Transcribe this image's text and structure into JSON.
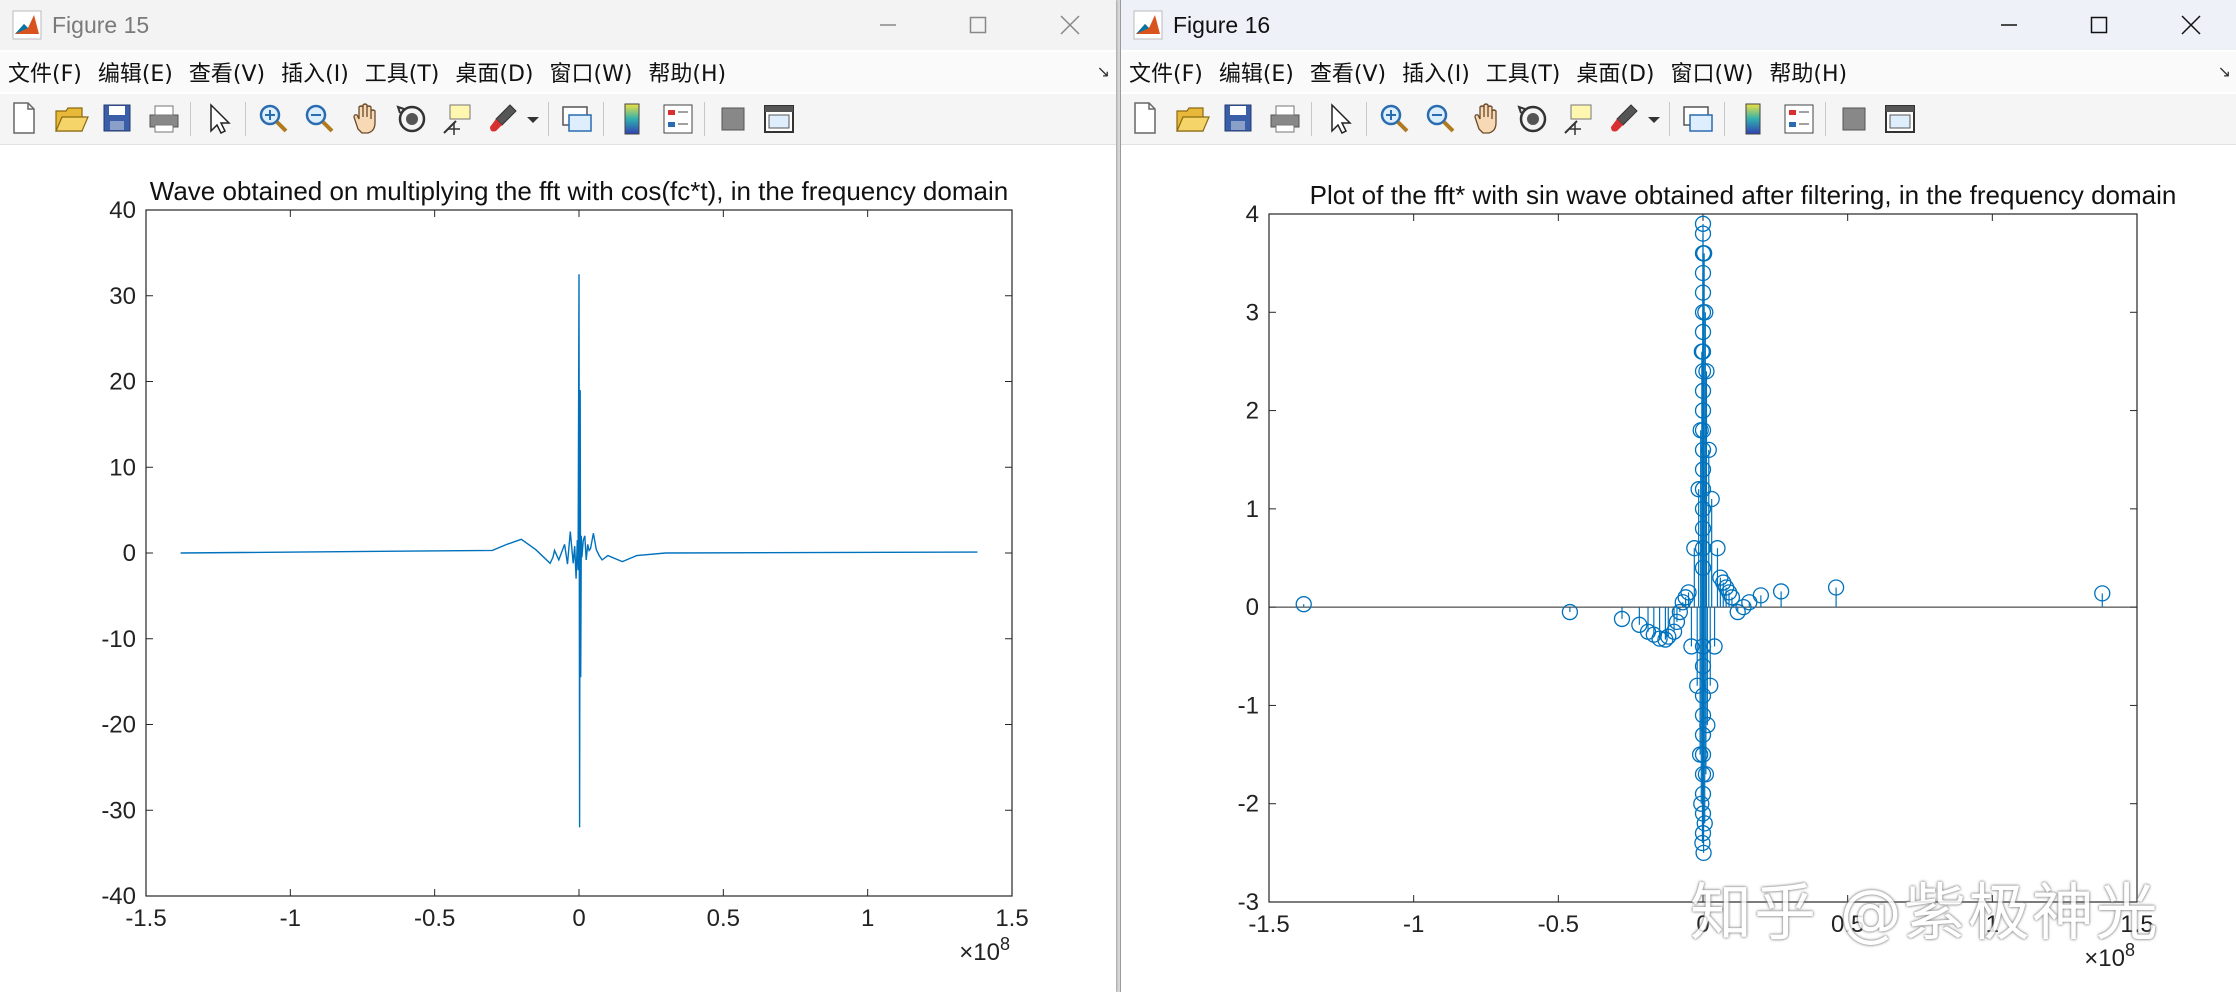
{
  "figure15": {
    "window_title": "Figure 15",
    "menu": [
      {
        "label": "文件(F)"
      },
      {
        "label": "编辑(E)"
      },
      {
        "label": "查看(V)"
      },
      {
        "label": "插入(I)"
      },
      {
        "label": "工具(T)"
      },
      {
        "label": "桌面(D)"
      },
      {
        "label": "窗口(W)"
      },
      {
        "label": "帮助(H)"
      }
    ]
  },
  "figure16": {
    "window_title": "Figure 16",
    "menu": [
      {
        "label": "文件(F)"
      },
      {
        "label": "编辑(E)"
      },
      {
        "label": "查看(V)"
      },
      {
        "label": "插入(I)"
      },
      {
        "label": "工具(T)"
      },
      {
        "label": "桌面(D)"
      },
      {
        "label": "窗口(W)"
      },
      {
        "label": "帮助(H)"
      }
    ]
  },
  "toolbar_icons": [
    "new-file-icon",
    "open-file-icon",
    "save-icon",
    "print-icon",
    "sep",
    "pointer-icon",
    "sep",
    "zoom-in-icon",
    "zoom-out-icon",
    "pan-hand-icon",
    "rotate-3d-icon",
    "data-cursor-icon",
    "brush-icon",
    "brush-dropdown-icon",
    "sep",
    "link-plot-icon",
    "sep",
    "colorbar-icon",
    "legend-icon",
    "sep",
    "hide-plot-tools-icon",
    "show-plot-tools-icon"
  ],
  "watermark": "知乎 @紫极神光",
  "colors": {
    "series": "#0072BD",
    "axis": "#262626",
    "baseline": "#262626"
  },
  "chart_data": [
    {
      "type": "line",
      "title": "Wave obtained on multiplying the fft with cos(fc*t), in the frequency domain",
      "xlim": [
        -1.5,
        1.5
      ],
      "ylim": [
        -40,
        40
      ],
      "x_ticks": [
        -1.5,
        -1,
        -0.5,
        0,
        0.5,
        1,
        1.5
      ],
      "y_ticks": [
        -40,
        -30,
        -20,
        -10,
        0,
        10,
        20,
        30,
        40
      ],
      "x_exponent": "×10^8",
      "grid": false,
      "series": [
        {
          "x": [
            -1.38,
            -0.3,
            -0.25,
            -0.2,
            -0.15,
            -0.1,
            -0.09,
            -0.085,
            -0.07,
            -0.05,
            -0.04,
            -0.03,
            -0.02,
            -0.015,
            -0.01,
            -0.006,
            -0.003,
            0.0,
            0.002,
            0.004,
            0.006,
            0.008,
            0.01,
            0.015,
            0.02,
            0.025,
            0.03,
            0.035,
            0.04,
            0.05,
            0.06,
            0.07,
            0.08,
            0.1,
            0.15,
            0.2,
            0.3,
            1.38
          ],
          "y": [
            0.0,
            0.3,
            1.0,
            1.6,
            0.4,
            -1.2,
            -0.5,
            0.3,
            -0.8,
            1.0,
            -1.3,
            2.5,
            -1.2,
            0.8,
            -3.0,
            1.5,
            -2.0,
            32.5,
            -32.0,
            19.0,
            -14.5,
            2.0,
            -0.5,
            1.5,
            2.0,
            -0.8,
            1.0,
            0.3,
            0.5,
            2.3,
            0.4,
            -0.3,
            -0.8,
            -0.3,
            -1.0,
            -0.3,
            0.0,
            0.1
          ]
        }
      ]
    },
    {
      "type": "stem",
      "title": "Plot of the fft* with sin wave obtained after filtering, in the frequency domain",
      "xlim": [
        -1.5,
        1.5
      ],
      "ylim": [
        -3,
        4
      ],
      "x_ticks": [
        -1.5,
        -1,
        -0.5,
        0,
        0.5,
        1,
        1.5
      ],
      "y_ticks": [
        -3,
        -2,
        -1,
        0,
        1,
        2,
        3,
        4
      ],
      "x_exponent": "×10^8",
      "grid": false,
      "series": [
        {
          "x": [
            -1.38,
            -0.46,
            -0.28,
            -0.22,
            -0.19,
            -0.17,
            -0.15,
            -0.13,
            -0.12,
            -0.1,
            -0.09,
            -0.08,
            -0.07,
            -0.06,
            -0.05,
            -0.04,
            -0.03,
            -0.02,
            -0.015,
            -0.01,
            -0.008,
            -0.006,
            -0.004,
            -0.002,
            0.0,
            0.002,
            0.004,
            0.006,
            0.008,
            0.01,
            0.012,
            0.015,
            0.02,
            0.025,
            0.03,
            0.04,
            0.05,
            0.06,
            0.07,
            0.08,
            0.09,
            0.1,
            0.12,
            0.14,
            0.16,
            0.2,
            0.27,
            0.46,
            1.38
          ],
          "y": [
            0.03,
            -0.05,
            -0.12,
            -0.18,
            -0.25,
            -0.28,
            -0.32,
            -0.33,
            -0.3,
            -0.25,
            -0.15,
            -0.05,
            0.05,
            0.1,
            0.15,
            -0.4,
            0.6,
            -0.8,
            1.2,
            -1.5,
            1.8,
            -2.0,
            2.6,
            -2.4,
            3.9,
            -2.5,
            3.6,
            -2.2,
            3.0,
            -1.7,
            2.4,
            -1.2,
            1.6,
            -0.8,
            1.1,
            -0.4,
            0.6,
            0.3,
            0.25,
            0.2,
            0.15,
            0.1,
            -0.05,
            0.0,
            0.05,
            0.12,
            0.16,
            0.2,
            0.14
          ]
        },
        {
          "x": [
            0.0,
            0.0,
            0.0,
            0.0,
            0.0,
            0.0,
            0.0,
            0.0,
            0.0,
            0.0,
            0.0,
            0.0,
            0.0,
            0.0,
            0.0,
            0.0,
            0.0,
            0.0,
            0.0,
            0.0,
            0.0,
            0.0,
            0.0,
            0.0,
            0.0,
            0.0,
            0.0,
            0.0
          ],
          "y": [
            3.8,
            3.6,
            3.4,
            3.2,
            3.0,
            2.8,
            2.6,
            2.4,
            2.2,
            2.0,
            1.8,
            1.6,
            1.4,
            1.2,
            1.0,
            0.8,
            0.6,
            0.4,
            -0.4,
            -0.6,
            -0.9,
            -1.1,
            -1.3,
            -1.5,
            -1.7,
            -1.9,
            -2.1,
            -2.3
          ]
        }
      ]
    }
  ]
}
